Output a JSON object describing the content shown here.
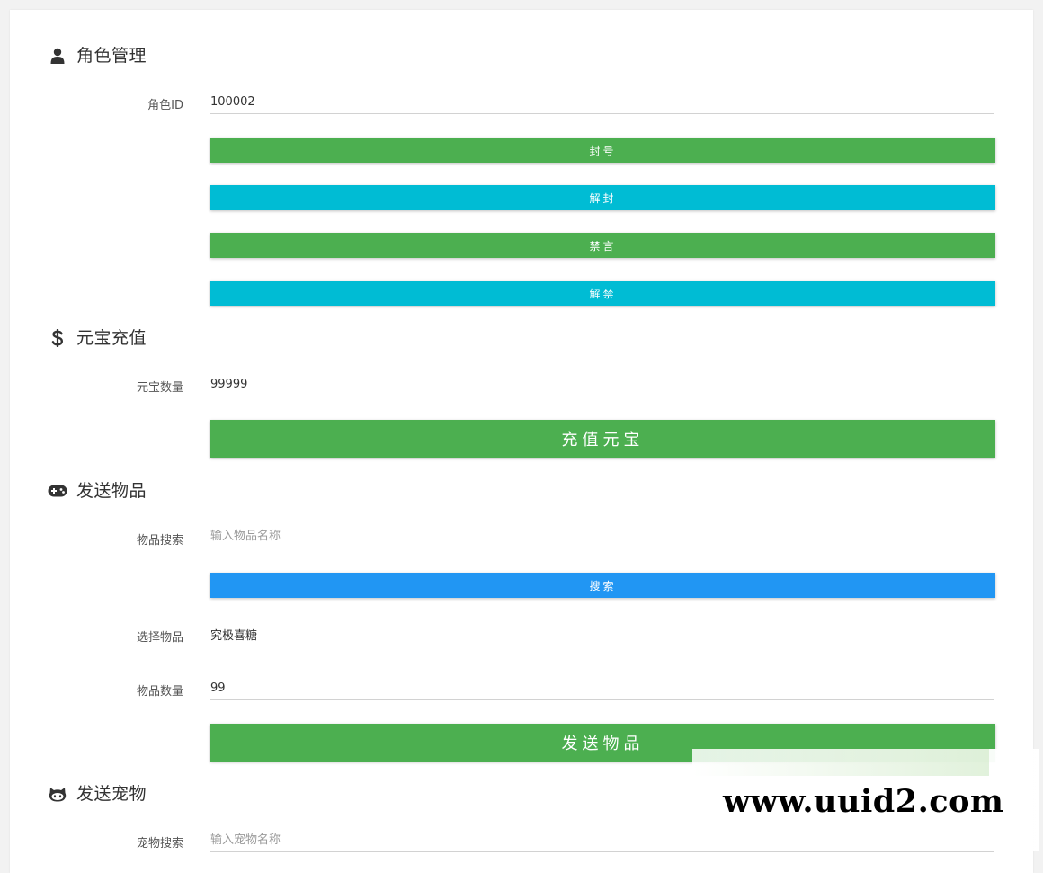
{
  "role": {
    "title": "角色管理",
    "id_label": "角色ID",
    "id_value": "100002",
    "ban_label": "封号",
    "unban_label": "解封",
    "mute_label": "禁言",
    "unmute_label": "解禁"
  },
  "gold": {
    "title": "元宝充值",
    "amount_label": "元宝数量",
    "amount_value": "99999",
    "recharge_label": "充值元宝"
  },
  "item": {
    "title": "发送物品",
    "search_label": "物品搜索",
    "search_placeholder": "输入物品名称",
    "search_button": "搜索",
    "select_label": "选择物品",
    "select_value": "究极喜糖",
    "qty_label": "物品数量",
    "qty_value": "99",
    "send_button": "发送物品"
  },
  "pet": {
    "title": "发送宠物",
    "search_label": "宠物搜索",
    "search_placeholder": "输入宠物名称"
  },
  "watermark": {
    "text": "www.uuid2.com"
  },
  "colors": {
    "green": "#4caf50",
    "cyan": "#00bcd4",
    "blue": "#2196f3"
  },
  "icons": {
    "role": "user-icon",
    "gold": "dollar-icon",
    "item": "gamepad-icon",
    "pet": "github-cat-icon"
  }
}
